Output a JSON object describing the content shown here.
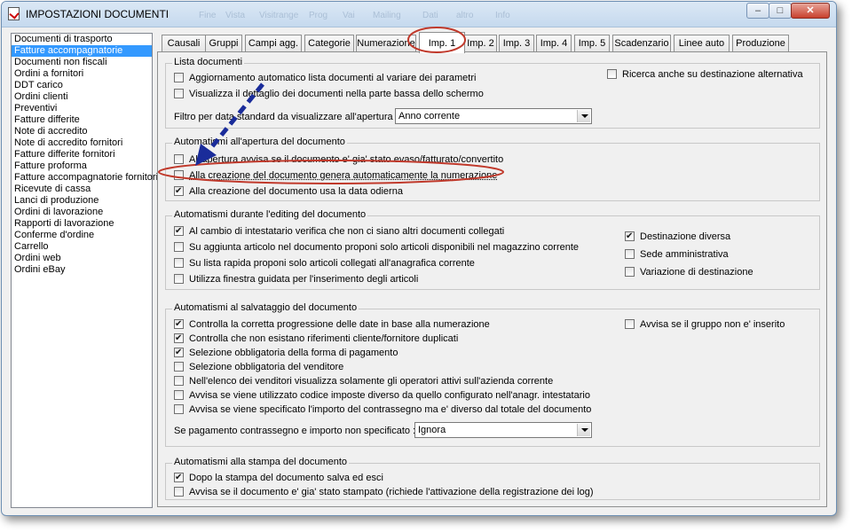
{
  "window": {
    "title": "IMPOSTAZIONI DOCUMENTI",
    "minimize_glyph": "–",
    "maximize_glyph": "□",
    "close_glyph": "✕",
    "ghost_menu": [
      "Fine",
      "Vista",
      "Visitrange",
      "Prog",
      "Vai",
      "Mailing",
      "Dati",
      "altro",
      "Info"
    ]
  },
  "document_types": [
    "Documenti di trasporto",
    "Fatture accompagnatorie",
    "Documenti non fiscali",
    "Ordini a fornitori",
    "DDT carico",
    "Ordini clienti",
    "Preventivi",
    "Fatture differite",
    "Note di accredito",
    "Note di accredito fornitori",
    "Fatture differite fornitori",
    "Fatture proforma",
    "Fatture accompagnatorie fornitori",
    "Ricevute di cassa",
    "Lanci di produzione",
    "Ordini di lavorazione",
    "Rapporti di lavorazione",
    "Conferme d'ordine",
    "Carrello",
    "Ordini web",
    "Ordini eBay"
  ],
  "selected_document_index": 1,
  "tabs": [
    "Causali",
    "Gruppi",
    "Campi agg.",
    "Categorie",
    "Numerazione",
    "Imp. 1",
    "Imp. 2",
    "Imp. 3",
    "Imp. 4",
    "Imp. 5",
    "Scadenzario",
    "Linee auto",
    "Produzione"
  ],
  "active_tab_index": 5,
  "lista_documenti": {
    "title": "Lista documenti",
    "opt_aggiornamento": {
      "label": "Aggiornamento automatico lista documenti al variare dei parametri",
      "checked": false
    },
    "opt_visualizza": {
      "label": "Visualizza il dettaglio dei documenti nella parte bassa dello schermo",
      "checked": false
    },
    "opt_ricerca": {
      "label": "Ricerca anche su destinazione alternativa",
      "checked": false
    },
    "filter_label": "Filtro per data standard da visualizzare all'apertura :",
    "filter_value": "Anno corrente"
  },
  "apertura": {
    "title": "Automatismi all'apertura del documento",
    "opt_avvisa": {
      "label": "All'apertura avvisa se il documento e' gia' stato evaso/fatturato/convertito",
      "checked": false
    },
    "opt_numerazione": {
      "label": "Alla creazione del documento genera automaticamente la numerazione",
      "checked": false
    },
    "opt_data": {
      "label": "Alla creazione del documento usa la data odierna",
      "checked": true
    }
  },
  "editing": {
    "title": "Automatismi durante l'editing del documento",
    "opt_cambio": {
      "label": "Al cambio di intestatario verifica che non ci siano altri documenti collegati",
      "checked": true
    },
    "opt_aggiunta": {
      "label": "Su aggiunta articolo nel documento proponi solo articoli disponibili nel magazzino corrente",
      "checked": false
    },
    "opt_rapida": {
      "label": "Su lista rapida proponi solo articoli collegati all'anagrafica corrente",
      "checked": false
    },
    "opt_guidata": {
      "label": "Utilizza finestra guidata per l'inserimento degli articoli",
      "checked": false
    },
    "opt_destinazione": {
      "label": "Destinazione diversa",
      "checked": true
    },
    "opt_sede": {
      "label": "Sede amministrativa",
      "checked": false
    },
    "opt_variazione": {
      "label": "Variazione di destinazione",
      "checked": false
    }
  },
  "salvataggio": {
    "title": "Automatismi al salvataggio del documento",
    "opt_progressione": {
      "label": "Controlla la corretta progressione delle date in base alla numerazione",
      "checked": true
    },
    "opt_riferimenti": {
      "label": "Controlla che non esistano riferimenti cliente/fornitore duplicati",
      "checked": true
    },
    "opt_pagamento": {
      "label": "Selezione obbligatoria della forma di pagamento",
      "checked": true
    },
    "opt_venditore": {
      "label": "Selezione obbligatoria del venditore",
      "checked": false
    },
    "opt_venditori_attivi": {
      "label": "Nell'elenco dei venditori visualizza solamente gli operatori attivi sull'azienda corrente",
      "checked": false
    },
    "opt_imposte": {
      "label": "Avvisa se viene utilizzato codice imposte diverso da quello configurato nell'anagr. intestatario",
      "checked": false
    },
    "opt_contrassegno": {
      "label": "Avvisa se viene specificato l'importo del contrassegno ma e' diverso dal totale del documento",
      "checked": false
    },
    "opt_gruppo": {
      "label": "Avvisa se il gruppo non e' inserito",
      "checked": false
    },
    "pagamento_label": "Se pagamento contrassegno e importo non specificato :",
    "pagamento_value": "Ignora"
  },
  "stampa": {
    "title": "Automatismi alla stampa del documento",
    "opt_salva": {
      "label": "Dopo la stampa del documento salva ed esci",
      "checked": true
    },
    "opt_stampato": {
      "label": "Avvisa se il documento e' gia' stato stampato (richiede l'attivazione della registrazione dei log)",
      "checked": false
    }
  },
  "annotation": {
    "circle_color": "#c0392b",
    "arrow_color": "#1a2c9a"
  }
}
